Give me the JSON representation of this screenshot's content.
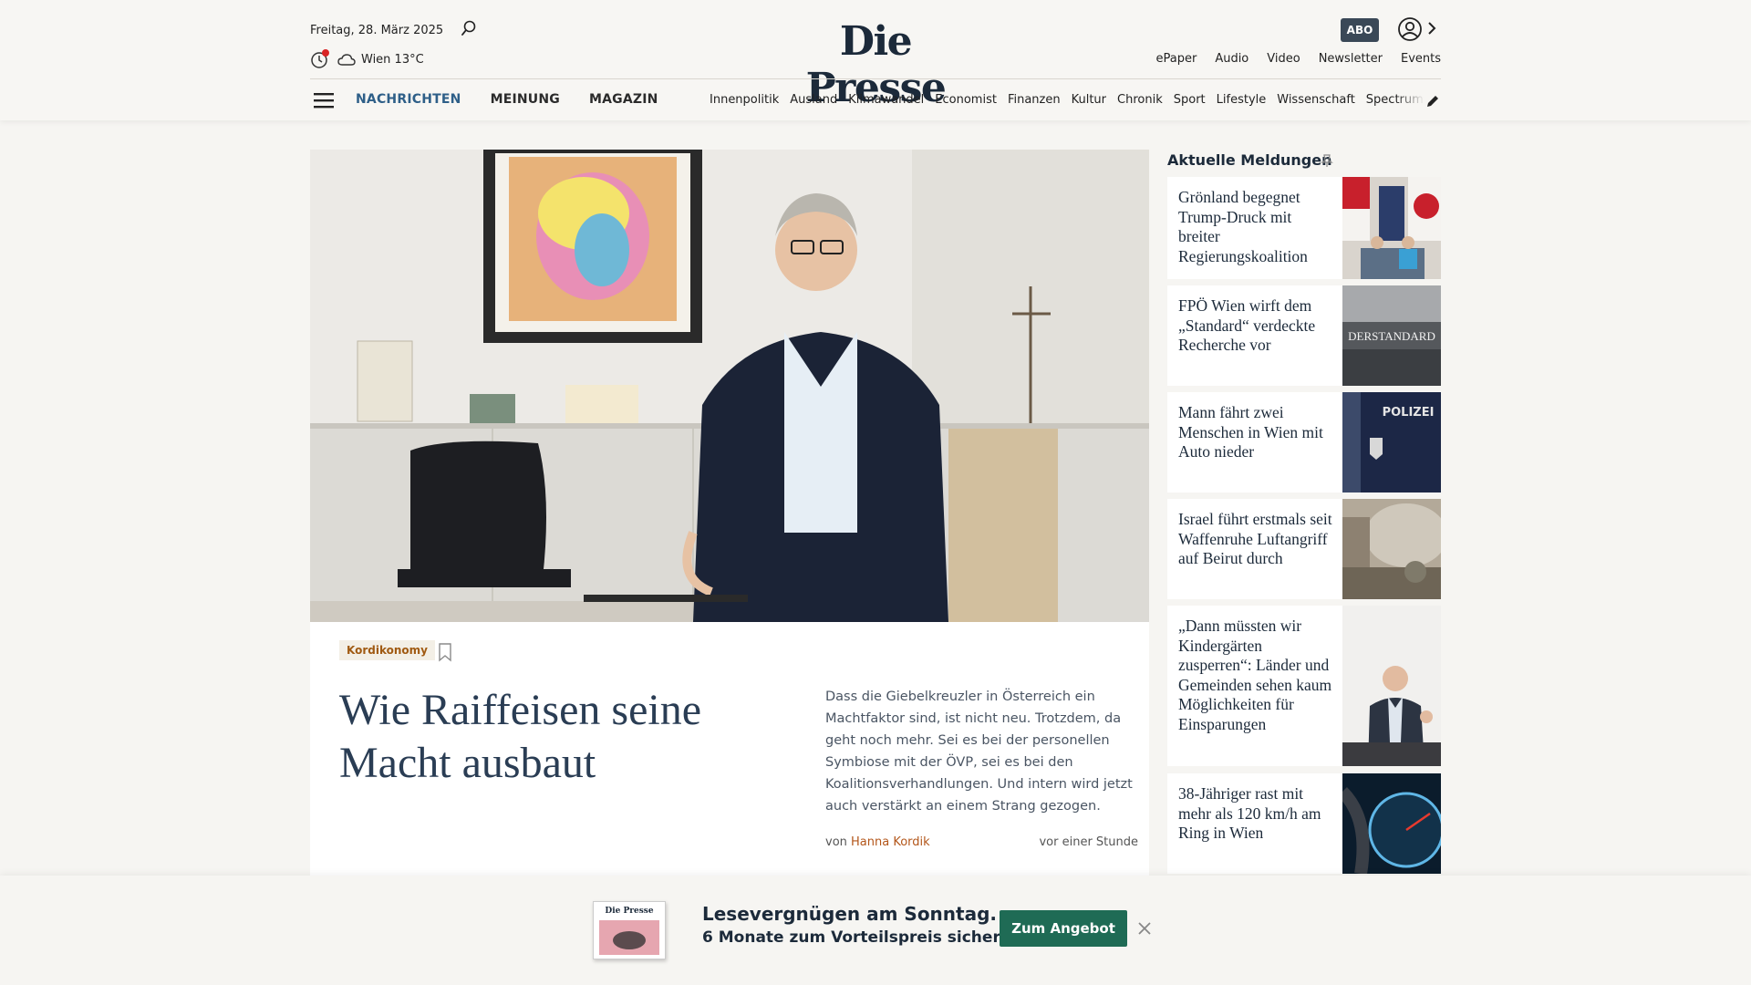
{
  "header": {
    "date": "Freitag, 28. März 2025",
    "weather": "Wien 13°C",
    "logo": "Die Presse",
    "abo_label": "ABO",
    "util_nav": [
      "ePaper",
      "Audio",
      "Video",
      "Newsletter",
      "Events"
    ]
  },
  "nav": {
    "main": [
      "NACHRICHTEN",
      "MEINUNG",
      "MAGAZIN"
    ],
    "sub": [
      "Innenpolitik",
      "Ausland",
      "Klimawandel",
      "Economist",
      "Finanzen",
      "Kultur",
      "Chronik",
      "Sport",
      "Lifestyle",
      "Wissenschaft",
      "Spectrum"
    ]
  },
  "hero": {
    "category": "Kordikonomy",
    "headline": "Wie Raiffeisen seine Macht ausbaut",
    "teaser": "Dass die Giebelkreuzler in Österreich ein Machtfaktor sind, ist nicht neu. Trotzdem, da geht noch mehr. Sei es bei der personellen Symbiose mit der ÖVP, sei es bei den Koalitionsverhandlungen. Und intern wird jetzt auch verstärkt an einem Strang gezogen.",
    "by_prefix": "von",
    "author": "Hanna Kordik",
    "time": "vor einer Stunde"
  },
  "sidebar": {
    "title": "Aktuelle Meldungen",
    "items": [
      {
        "title": "Grönland begegnet Trump-Druck mit breiter Regierungskoalition",
        "thumb": "greenland-flags-photo"
      },
      {
        "title": "FPÖ Wien wirft dem „Standard“ verdeckte Recherche vor",
        "thumb": "derstandard-building-photo",
        "thumb_text": "DERSTANDARD"
      },
      {
        "title": "Mann fährt zwei Menschen in Wien mit Auto nieder",
        "thumb": "police-officer-photo",
        "thumb_text": "POLIZEI"
      },
      {
        "title": "Israel führt erstmals seit Waffenruhe Luftangriff auf Beirut durch",
        "thumb": "beirut-smoke-photo"
      },
      {
        "title": "„Dann müssten wir Kindergärten zusperren“: Länder und Gemeinden sehen kaum Möglichkeiten für Einsparungen",
        "thumb": "politician-speaking-photo"
      },
      {
        "title": "38-Jähriger rast mit mehr als 120 km/h am Ring in Wien",
        "thumb": "speedometer-photo"
      }
    ]
  },
  "promo": {
    "title": "Lesevergnügen am Sonntag.",
    "subtitle": "6 Monate zum Vorteilspreis sichern.",
    "button": "Zum Angebot",
    "thumb_logo": "Die Presse"
  },
  "colors": {
    "brand_navy": "#1c2a3a",
    "nav_active": "#2e5f88",
    "accent_orange": "#b3561a",
    "promo_green": "#1f6b55"
  }
}
